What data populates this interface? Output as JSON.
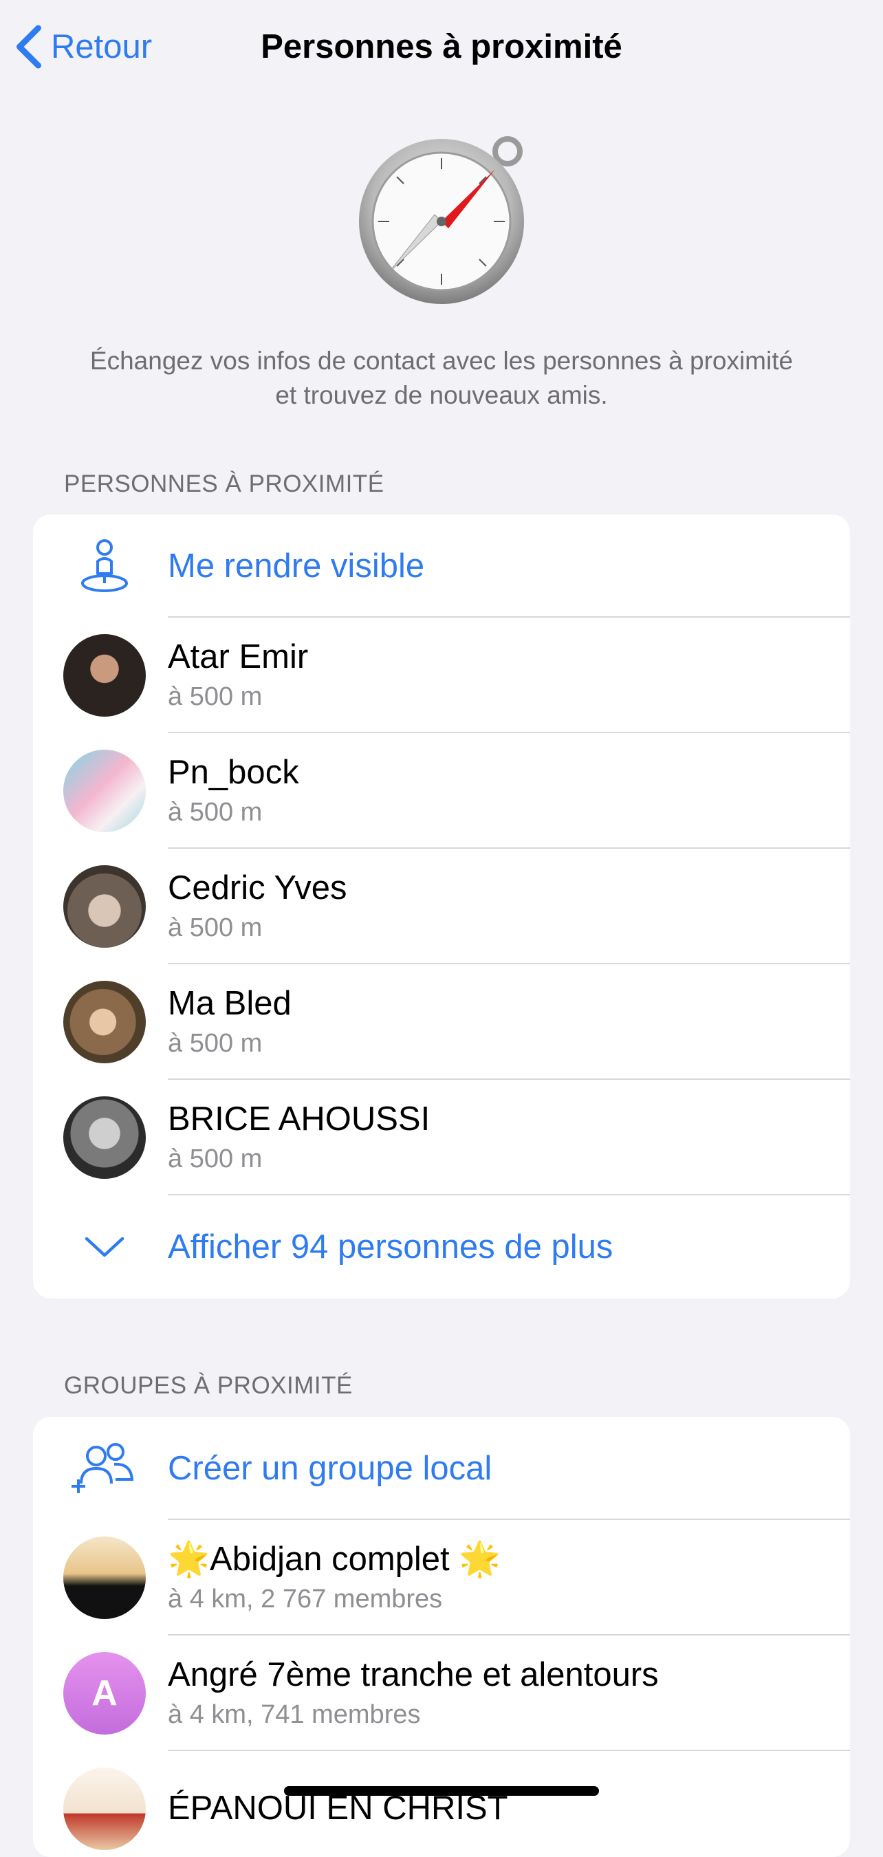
{
  "navbar": {
    "back_label": "Retour",
    "title": "Personnes à proximité"
  },
  "hero_icon": "compass-icon",
  "intro_text": "Échangez vos infos de contact avec les personnes à proximité et trouvez de nouveaux amis.",
  "people_section": {
    "header": "PERSONNES À PROXIMITÉ",
    "action_label": "Me rendre visible",
    "items": [
      {
        "name_first": "Atar",
        "name_rest": " Emir",
        "distance": "à 500 m"
      },
      {
        "name_first": "Pn_bock",
        "name_rest": "",
        "distance": "à 500 m"
      },
      {
        "name_first": "Cedric",
        "name_rest": " Yves",
        "distance": "à 500 m"
      },
      {
        "name_first": "Ma Bled",
        "name_rest": "",
        "distance": "à 500 m"
      },
      {
        "name_first": "BRICE",
        "name_rest": " AHOUSSI",
        "distance": "à 500 m"
      }
    ],
    "show_more_label": "Afficher 94 personnes de plus"
  },
  "groups_section": {
    "header": "GROUPES À PROXIMITÉ",
    "action_label": "Créer un groupe local",
    "items": [
      {
        "name": "🌟Abidjan complet 🌟",
        "info": "à 4 km, 2 767 membres",
        "avatar_letter": ""
      },
      {
        "name": "Angré 7ème tranche et alentours",
        "info": "à 4 km, 741 membres",
        "avatar_letter": "A"
      },
      {
        "name": "ÉPANOUI EN CHRIST",
        "info": "",
        "avatar_letter": ""
      }
    ]
  },
  "colors": {
    "accent": "#2f7bf0",
    "background": "#f2f2f7",
    "secondary_text": "#8e8e93"
  }
}
